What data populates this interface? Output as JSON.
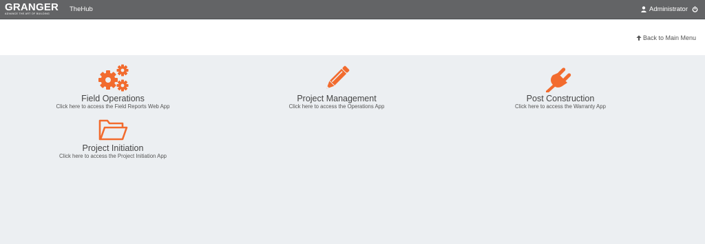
{
  "header": {
    "logo_text": "GRANGER",
    "logo_tagline": "ADVANCE THE ART OF BUILDING",
    "app_title": "TheHub",
    "user_name": "Administrator",
    "user_icon": "user-icon",
    "power_icon": "power-icon"
  },
  "nav": {
    "back_label": "Back to Main Menu",
    "back_icon": "arrow-up-icon"
  },
  "accent_color": "#f26b2e",
  "apps": [
    {
      "title": "Field Operations",
      "subtitle": "Click here to access the Field Reports Web App",
      "icon": "gears-icon"
    },
    {
      "title": "Project Management",
      "subtitle": "Click here to access the Operations App",
      "icon": "pencil-icon"
    },
    {
      "title": "Post Construction",
      "subtitle": "Click here to access the Warranty App",
      "icon": "plug-icon"
    },
    {
      "title": "Project Initiation",
      "subtitle": "Click here to access the Project Initiation App",
      "icon": "folder-open-icon"
    }
  ]
}
